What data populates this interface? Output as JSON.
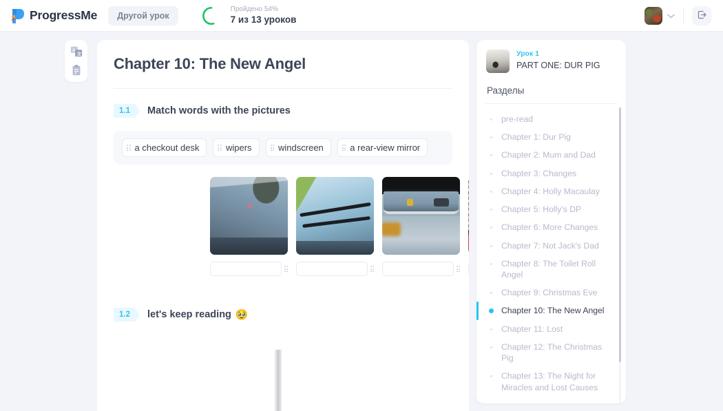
{
  "header": {
    "brand": "ProgressMe",
    "other_lesson_button": "Другой урок",
    "progress_label": "Пройдено 54%",
    "progress_count": "7 из 13 уроков",
    "progress_percent": 54,
    "accent_green": "#20c46a",
    "avatar_alt": "user-avatar",
    "logout_label": "Выход"
  },
  "tool_rail": {
    "translate_icon": "translate-icon",
    "notes_icon": "clipboard-icon"
  },
  "main": {
    "title": "Chapter 10: The New Angel",
    "sections": [
      {
        "number": "1.1",
        "title": "Match words with the pictures",
        "emoji": ""
      },
      {
        "number": "1.2",
        "title": "let's keep reading",
        "emoji": "🥹"
      }
    ],
    "word_chips": [
      "a checkout desk",
      "wipers",
      "windscreen",
      "a rear-view mirror"
    ],
    "picture_items": [
      {
        "alt": "car-windscreen-photo",
        "answer": ""
      },
      {
        "alt": "windscreen-wipers-photo",
        "answer": ""
      },
      {
        "alt": "rear-view-mirror-photo",
        "answer": ""
      },
      {
        "alt": "shop-checkout-desk-photo",
        "answer": ""
      }
    ]
  },
  "right_panel": {
    "lesson_number": "Урок 1",
    "lesson_name": "PART ONE: DUR PIG",
    "sections_label": "Разделы",
    "chapters": [
      {
        "label": "pre-read",
        "active": false
      },
      {
        "label": "Chapter 1: Dur Pig",
        "active": false
      },
      {
        "label": "Chapter 2: Mum and Dad",
        "active": false
      },
      {
        "label": "Chapter 3: Changes",
        "active": false
      },
      {
        "label": "Chapter 4: Holly Macaulay",
        "active": false
      },
      {
        "label": "Chapter 5: Holly's DP",
        "active": false
      },
      {
        "label": "Chapter 6: More Changes",
        "active": false
      },
      {
        "label": "Chapter 7: Not Jack's Dad",
        "active": false
      },
      {
        "label": "Chapter 8: The Toilet Roll Angel",
        "active": false
      },
      {
        "label": "Chapter 9: Christmas Eve",
        "active": false
      },
      {
        "label": "Chapter 10: The New Angel",
        "active": true
      },
      {
        "label": "Chapter 11: Lost",
        "active": false
      },
      {
        "label": "Chapter 12: The Christmas Pig",
        "active": false
      },
      {
        "label": "Chapter 13: The Night for Miracles and Lost Causes",
        "active": false
      }
    ]
  },
  "colors": {
    "accent_cyan": "#22c6f0",
    "badge_bg": "#e9f8fe",
    "page_bg": "#f3f4f9",
    "text_dark": "#3d4557",
    "text_muted": "#b7bacb"
  }
}
